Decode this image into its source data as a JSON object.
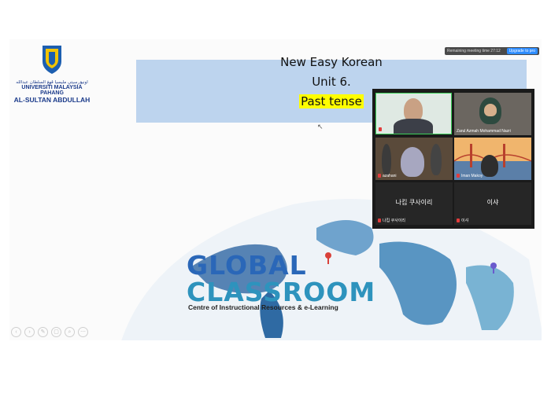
{
  "university": {
    "arabic": "اونيۏرسيتي مليسيا ڤهڠ السلطان عبدالله",
    "line2": "UNIVERSITI MALAYSIA PAHANG",
    "line3": "AL-SULTAN ABDULLAH",
    "shield_text": "UMPSA"
  },
  "slide": {
    "title": "New Easy Korean",
    "unit": "Unit 6.",
    "topic": "Past tense",
    "brand_global": "GLOBAL",
    "brand_classroom": "CLASSROOM",
    "brand_sub": "Centre of Instructional Resources & e-Learning",
    "controls": [
      "‹",
      "›",
      "✎",
      "▢",
      "⌕",
      "⋯"
    ]
  },
  "meeting": {
    "remaining": "Remaining meeting time 27:12",
    "upgrade": "Upgrade to pro"
  },
  "participants": [
    {
      "name": ""
    },
    {
      "name": "Zarul Azmah Mohammad Nazri"
    },
    {
      "name": "azahani"
    },
    {
      "name": "Iman Makoy"
    },
    {
      "name": "나킵 쿠사이리",
      "label": "나킵 쿠사이리"
    },
    {
      "name": "이샤",
      "label": "이샤"
    }
  ],
  "colors": {
    "title_box": "#bdd4ee",
    "highlight": "#ffff00",
    "global_blue": "#2a67b8",
    "classroom_teal": "#2e93bd",
    "active_speaker": "#3ccf5a"
  }
}
